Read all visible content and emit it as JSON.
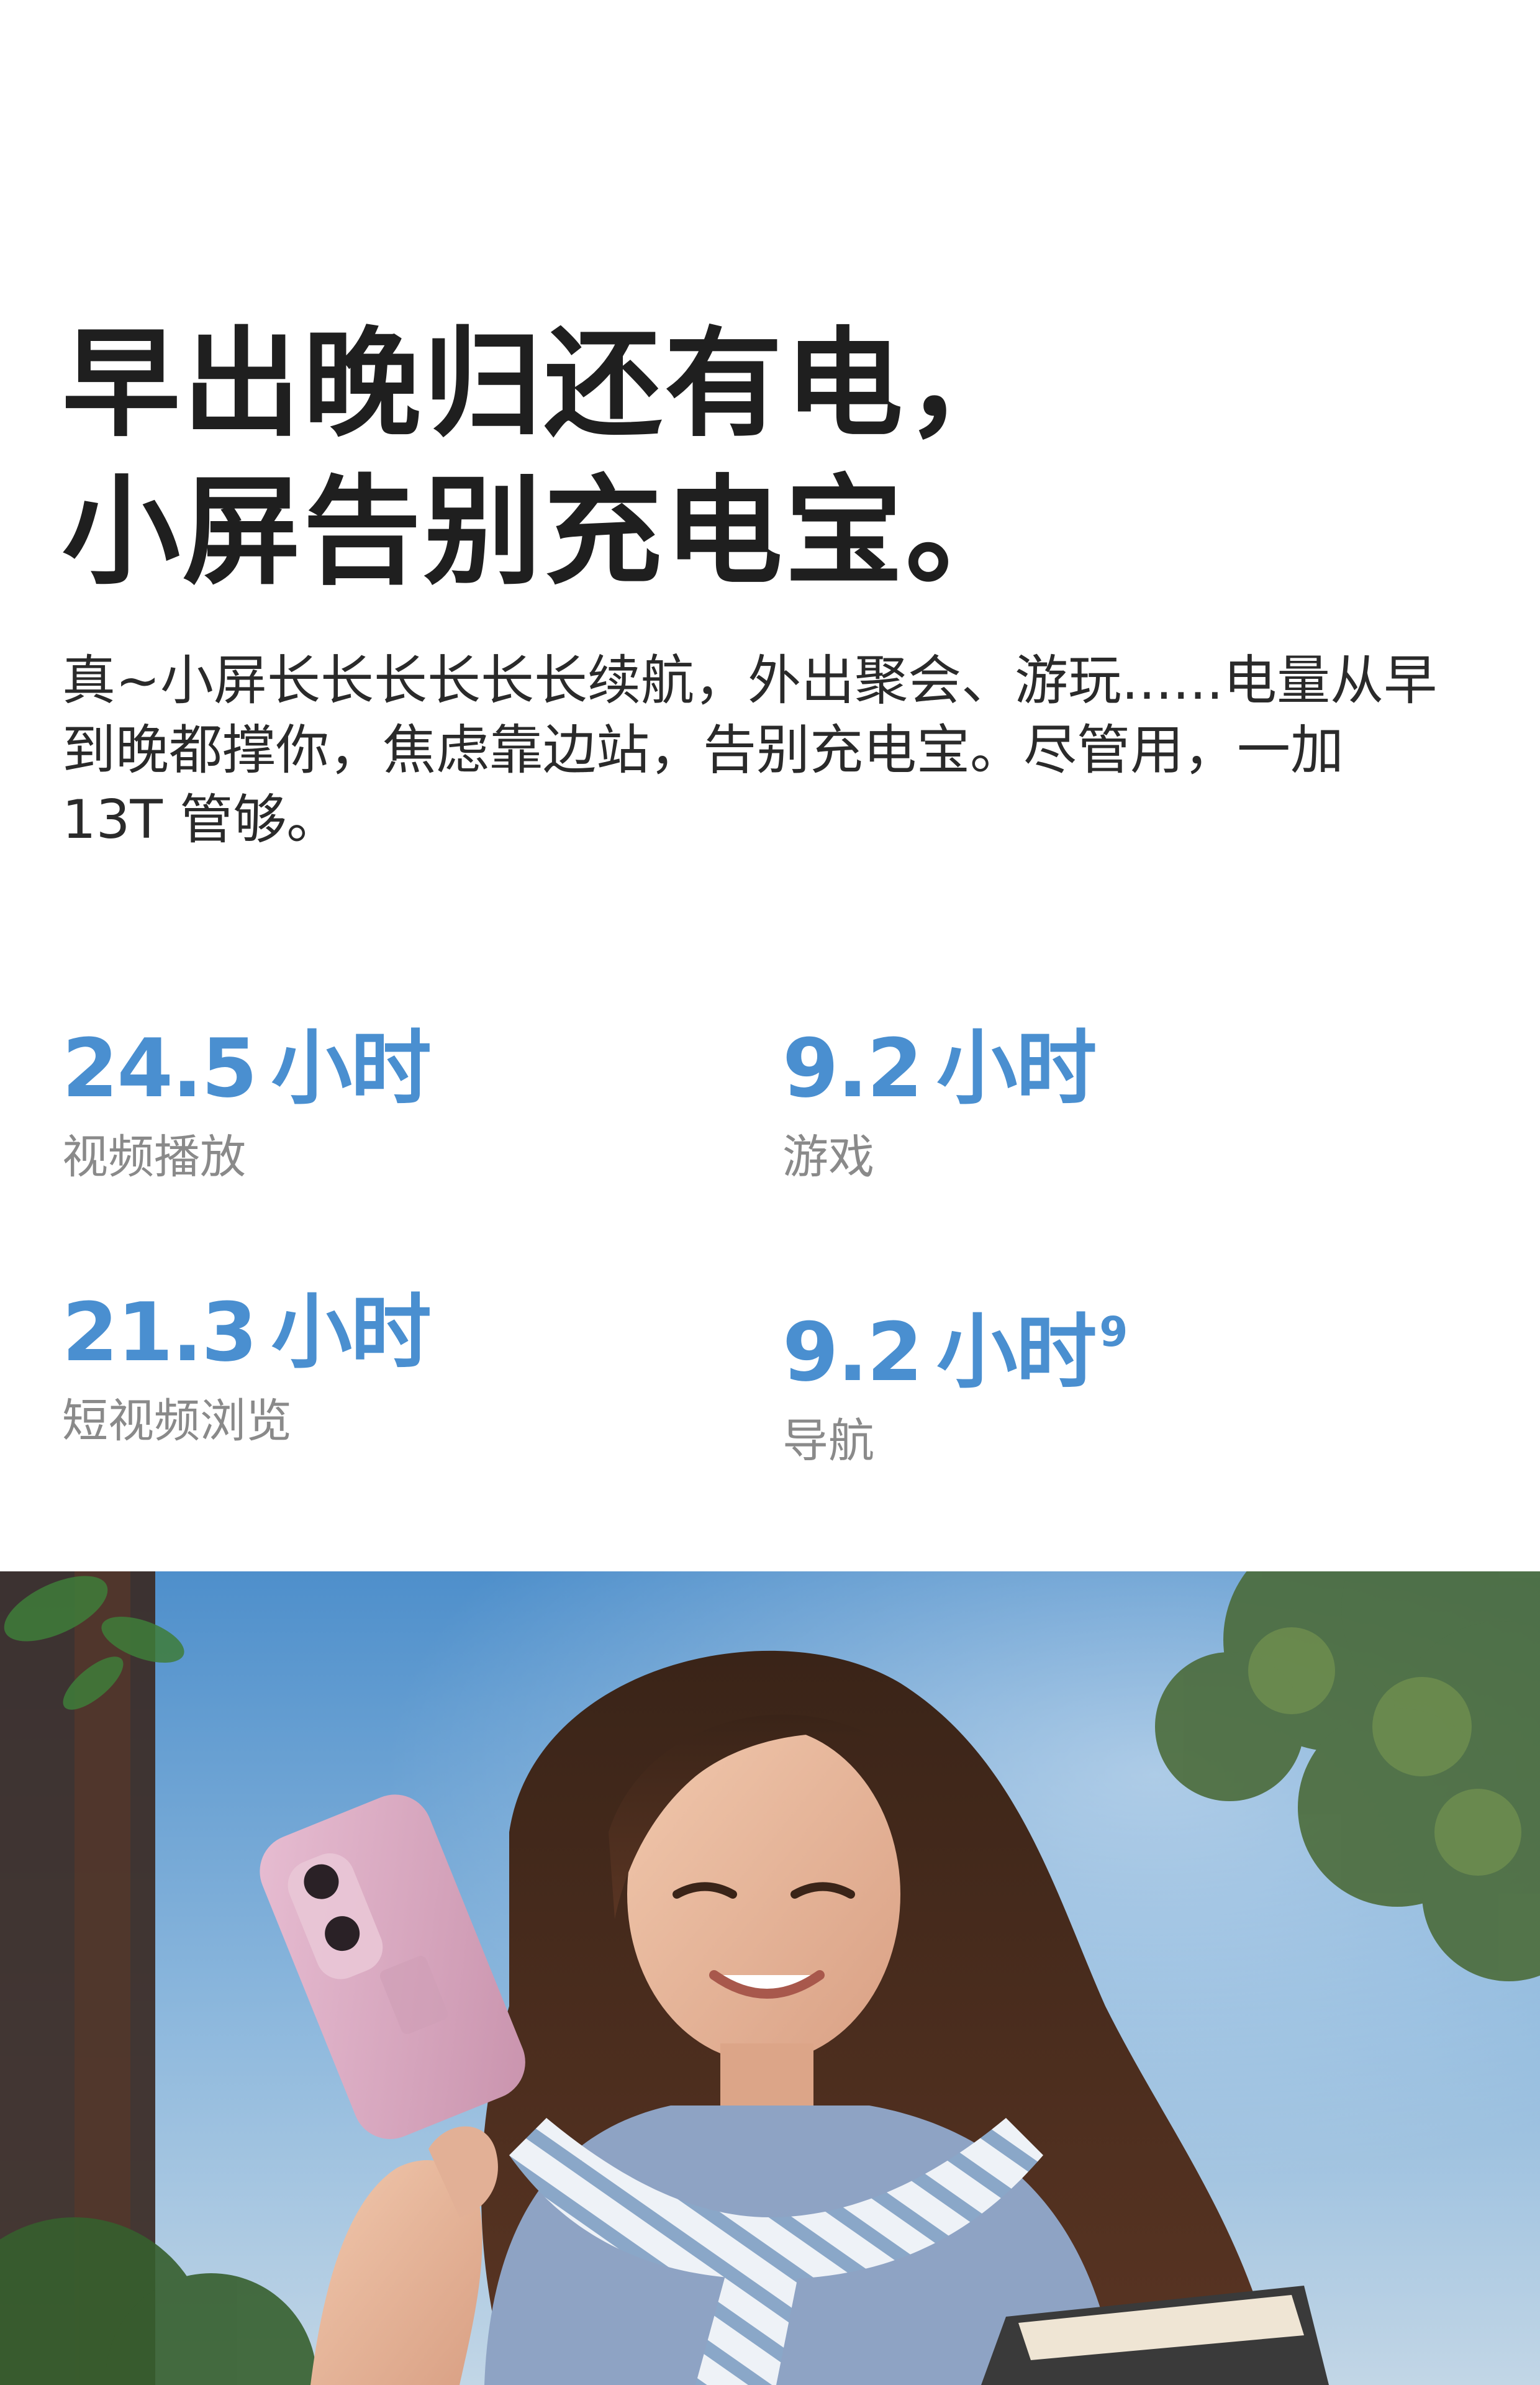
{
  "headline": {
    "line1": "早出晚归还有电，",
    "line2": "小屏告别充电宝。"
  },
  "body": {
    "text": "真~小屏长长长长长长续航，外出聚会、游玩......电量从早到晚都撑你，焦虑靠边站，告别充电宝。尽管用，一加 13T 管够。"
  },
  "stats": [
    {
      "value": "24.5",
      "unit": "小时",
      "footnote": "",
      "label": "视频播放"
    },
    {
      "value": "9.2",
      "unit": "小时",
      "footnote": "",
      "label": "游戏"
    },
    {
      "value": "21.3",
      "unit": "小时",
      "footnote": "",
      "label": "短视频浏览"
    },
    {
      "value": "9.2",
      "unit": "小时",
      "footnote": "9",
      "label": "导航"
    }
  ],
  "colors": {
    "accent": "#4a8fd0",
    "label": "#8a8a8a",
    "text": "#1f1f1f",
    "phone": "#d7a9c0"
  }
}
